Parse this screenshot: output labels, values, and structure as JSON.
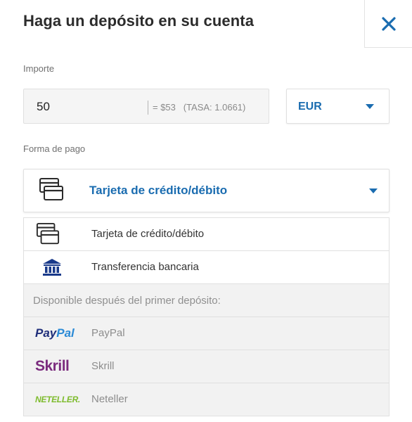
{
  "header": {
    "title": "Haga un depósito en su cuenta",
    "close_icon": "close-icon"
  },
  "amount": {
    "label": "Importe",
    "value": "50",
    "conversion": "= $53   (TASA: 1.0661)"
  },
  "currency": {
    "selected": "EUR"
  },
  "payment": {
    "label": "Forma de pago",
    "selected": "Tarjeta de crédito/débito",
    "options": [
      {
        "label": "Tarjeta de crédito/débito",
        "icon": "credit-card-icon"
      },
      {
        "label": "Transferencia bancaria",
        "icon": "bank-icon"
      }
    ],
    "after_first_deposit_note": "Disponible después del primer depósito:",
    "locked_options": [
      {
        "label": "PayPal",
        "logo_a": "Pay",
        "logo_b": "Pal"
      },
      {
        "label": "Skrill",
        "logo": "Skrill"
      },
      {
        "label": "Neteller",
        "logo": "NETELLER."
      }
    ]
  },
  "colors": {
    "accent": "#1a6cb0",
    "paypal_dark": "#1f2e7a",
    "paypal_light": "#2b8ad6",
    "skrill": "#7b2b7e",
    "neteller": "#7dbb2c"
  }
}
